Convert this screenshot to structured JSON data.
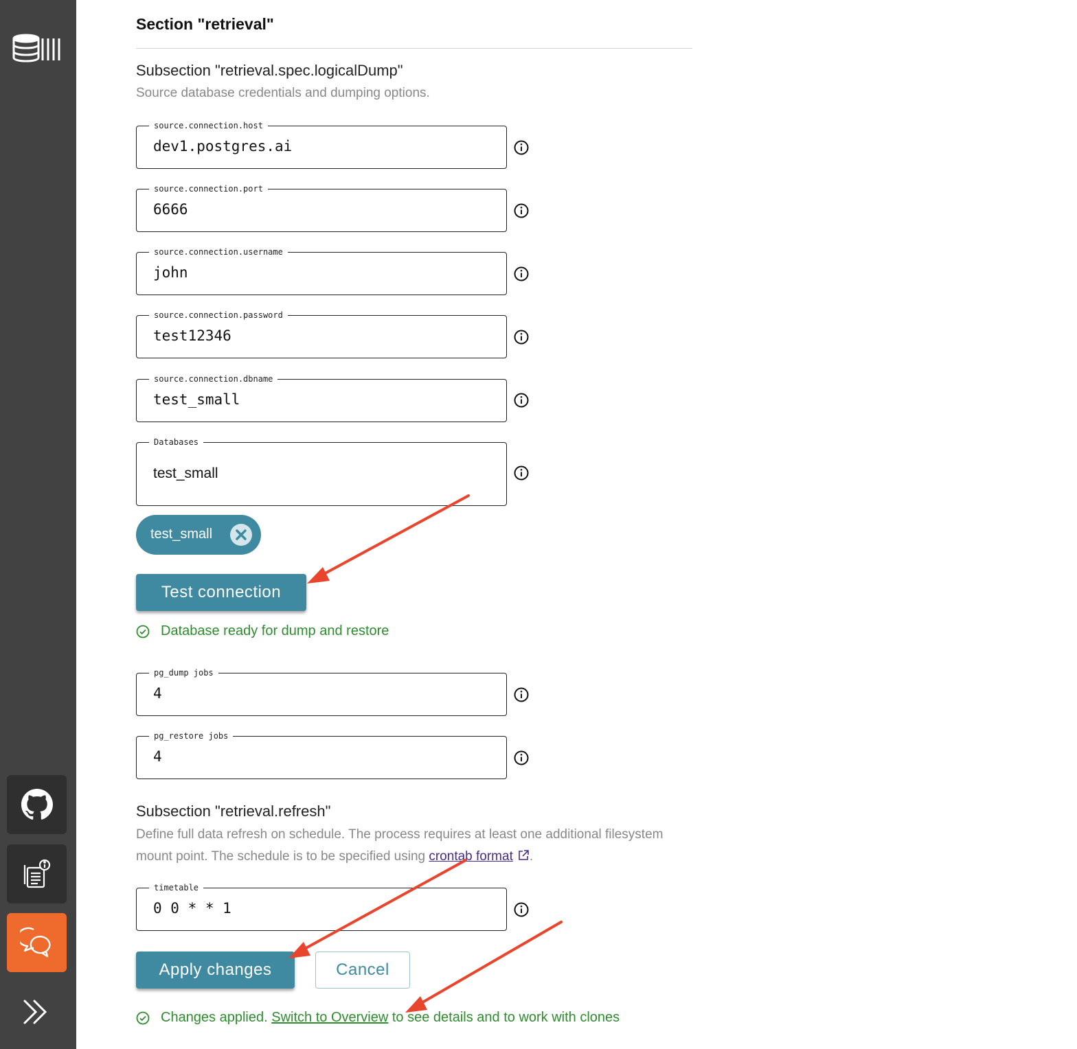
{
  "colors": {
    "sidebar_bg": "#424242",
    "sidebar_button_bg": "#2f2f2f",
    "sidebar_active": "#ee6b2d",
    "accent": "#3f8aa0",
    "success": "#2e8b2e",
    "annotation_arrow": "#e8452c"
  },
  "sidebar": {
    "logo_icon": "database-logo-icon",
    "buttons": [
      {
        "icon": "github-icon"
      },
      {
        "icon": "docs-info-icon"
      },
      {
        "icon": "chat-icon"
      }
    ],
    "expand_icon": "double-chevron-right-icon"
  },
  "section": {
    "title": "Section \"retrieval\""
  },
  "logical_dump": {
    "title": "Subsection \"retrieval.spec.logicalDump\"",
    "description": "Source database credentials and dumping options.",
    "fields": {
      "host": {
        "label": "source.connection.host",
        "value": "dev1.postgres.ai"
      },
      "port": {
        "label": "source.connection.port",
        "value": "6666"
      },
      "username": {
        "label": "source.connection.username",
        "value": "john"
      },
      "password": {
        "label": "source.connection.password",
        "value": "test12346"
      },
      "dbname": {
        "label": "source.connection.dbname",
        "value": "test_small"
      },
      "databases": {
        "label": "Databases",
        "value": "test_small"
      }
    },
    "chip": {
      "label": "test_small"
    },
    "test_button": "Test connection",
    "test_status": "Database ready for dump and restore",
    "dump_jobs": {
      "label": "pg_dump jobs",
      "value": "4"
    },
    "restore_jobs": {
      "label": "pg_restore jobs",
      "value": "4"
    }
  },
  "refresh": {
    "title": "Subsection \"retrieval.refresh\"",
    "description_before": "Define full data refresh on schedule. The process requires at least one additional filesystem mount point. The schedule is to be specified using ",
    "link_text": "crontab format",
    "description_after": ".",
    "timetable": {
      "label": "timetable",
      "value": "0 0 * * 1"
    }
  },
  "actions": {
    "apply": "Apply changes",
    "cancel": "Cancel",
    "status_prefix": "Changes applied.",
    "status_link": "Switch to Overview",
    "status_suffix": "to see details and to work with clones"
  }
}
